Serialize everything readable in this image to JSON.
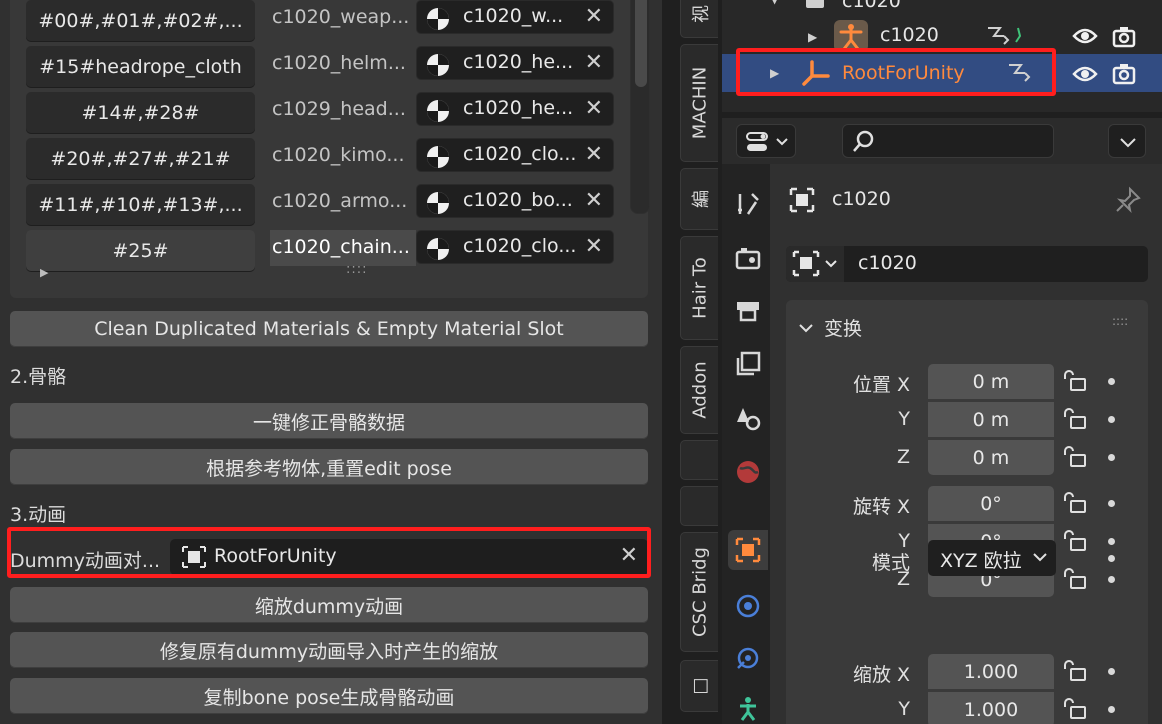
{
  "materials": {
    "rows": [
      {
        "button": "#00#,#01#,#02#,...",
        "name": "c1020_weap...",
        "slot": "c1020_w..."
      },
      {
        "button": "#15#headrope_cloth",
        "name": "c1020_helm...",
        "slot": "c1020_he..."
      },
      {
        "button": "#14#,#28#",
        "name": "c1029_head...",
        "slot": "c1020_he..."
      },
      {
        "button": "#20#,#27#,#21#",
        "name": "c1020_kimo...",
        "slot": "c1020_clo..."
      },
      {
        "button": "#11#,#10#,#13#,...",
        "name": "c1020_armo...",
        "slot": "c1020_bo..."
      },
      {
        "button": "#25#",
        "name": "c1020_chain...",
        "slot": "c1020_clo..."
      }
    ],
    "grip": "::::"
  },
  "buttons": {
    "clean": "Clean Duplicated Materials & Empty Material Slot",
    "fix_bones": "一键修正骨骼数据",
    "reset_pose": "根据参考物体,重置edit pose",
    "scale_dummy": "缩放dummy动画",
    "fix_dummy_scale": "修复原有dummy动画导入时产生的缩放",
    "copy_bone_pose": "复制bone pose生成骨骼动画"
  },
  "sections": {
    "bones": "2.骨骼",
    "animation": "3.动画"
  },
  "dummy": {
    "label": "Dummy动画对...",
    "value": "RootForUnity"
  },
  "tabs": [
    "视",
    "MACHIN",
    "編",
    "Hair To",
    "Addon",
    "CSC Bridg",
    "□"
  ],
  "outliner": {
    "parent": "c1020",
    "armature": "c1020",
    "root": "RootForUnity"
  },
  "properties": {
    "object_title": "c1020",
    "object_name": "c1020",
    "transform_header": "变换",
    "location_label": "位置 X",
    "rotation_label": "旋转 X",
    "scale_label": "缩放 X",
    "axis_y": "Y",
    "axis_z": "Z",
    "location": [
      "0 m",
      "0 m",
      "0 m"
    ],
    "rotation": [
      "0°",
      "0°",
      "0°"
    ],
    "mode_label": "模式",
    "mode_value": "XYZ 欧拉",
    "scale": [
      "1.000",
      "1.000"
    ]
  },
  "colors": {
    "highlight_red": "#ff1e1e",
    "selection_blue": "#324c82",
    "object_orange": "#ff8a3d"
  }
}
